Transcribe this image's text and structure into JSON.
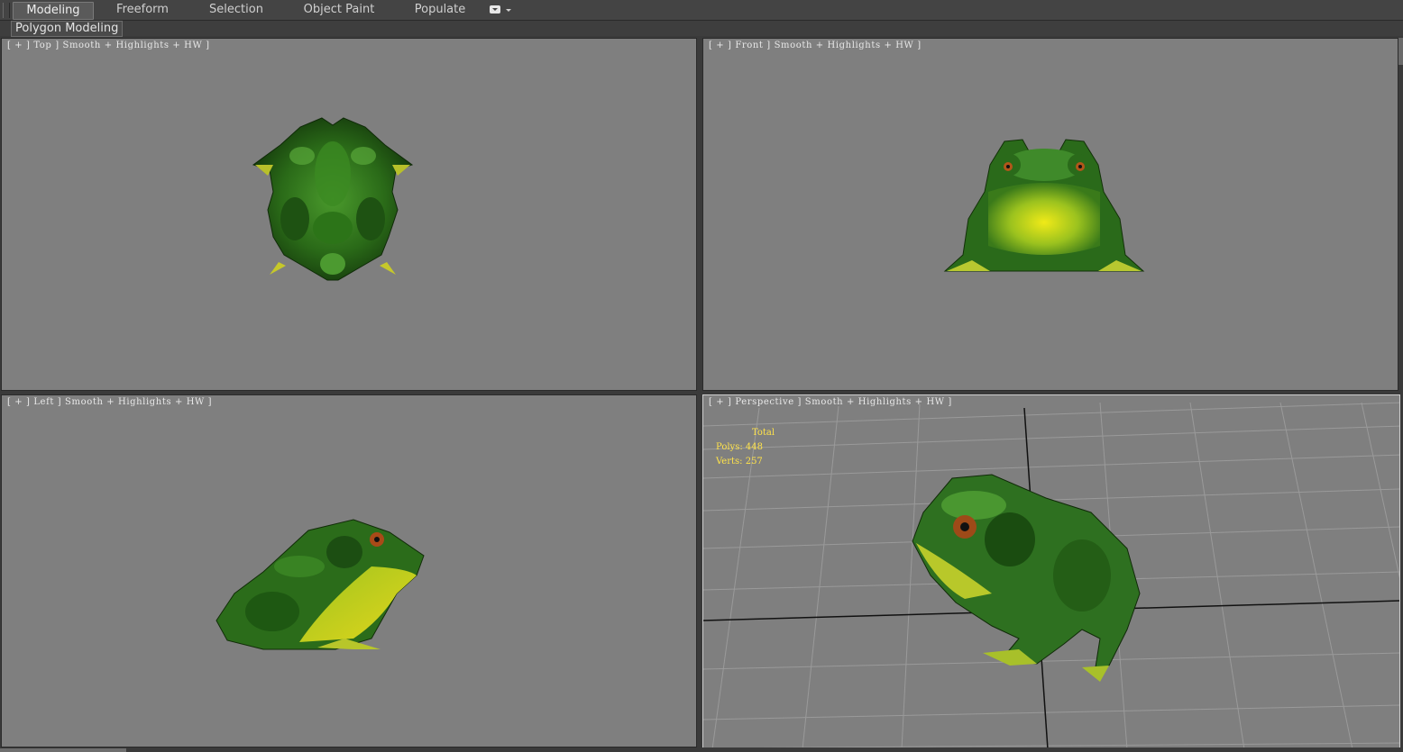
{
  "ribbon": {
    "tabs": [
      {
        "label": "Modeling",
        "active": true
      },
      {
        "label": "Freeform",
        "active": false
      },
      {
        "label": "Selection",
        "active": false
      },
      {
        "label": "Object Paint",
        "active": false
      },
      {
        "label": "Populate",
        "active": false
      }
    ],
    "options_icon": "ribbon-options-icon",
    "panel_label": "Polygon Modeling"
  },
  "viewports": {
    "top": {
      "label": "[ + ] Top ] Smooth + Highlights + HW ]"
    },
    "front": {
      "label": "[ + ] Front ] Smooth + Highlights + HW ]"
    },
    "left": {
      "label": "[ + ] Left ] Smooth + Highlights + HW ]"
    },
    "perspective": {
      "label": "[ + ] Perspective ] Smooth + Highlights + HW ]"
    }
  },
  "stats": {
    "title": "Total",
    "polys": "Polys: 448",
    "verts": "Verts: 257"
  },
  "colors": {
    "viewport_bg": "#7f7f7f",
    "stats_text": "#ffe34a",
    "frog_dark": "#1b4a12",
    "frog_mid": "#2f7a1c",
    "frog_belly": "#c8d41a"
  }
}
